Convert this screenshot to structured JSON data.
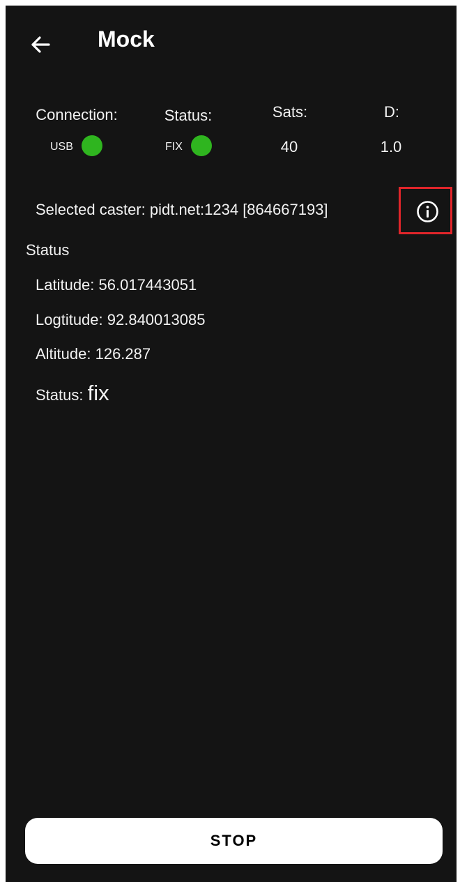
{
  "header": {
    "title": "Mock",
    "back_icon": "arrow-left-icon"
  },
  "stats": {
    "connection": {
      "label": "Connection:",
      "value": "USB",
      "indicator_color": "#2fb51f"
    },
    "status": {
      "label": "Status:",
      "value": "FIX",
      "indicator_color": "#2fb51f"
    },
    "sats": {
      "label": "Sats:",
      "value": "40"
    },
    "d": {
      "label": "D:",
      "value": "1.0"
    }
  },
  "caster": {
    "text": "Selected caster: pidt.net:1234 [864667193]",
    "info_icon": "info-icon",
    "highlight_color": "#e0252a"
  },
  "status_section": {
    "title": "Status",
    "latitude": "Latitude: 56.017443051",
    "longitude": "Logtitude: 92.840013085",
    "altitude": "Altitude: 126.287",
    "status_label": "Status: ",
    "status_value": "fix"
  },
  "footer": {
    "stop_label": "STOP"
  }
}
